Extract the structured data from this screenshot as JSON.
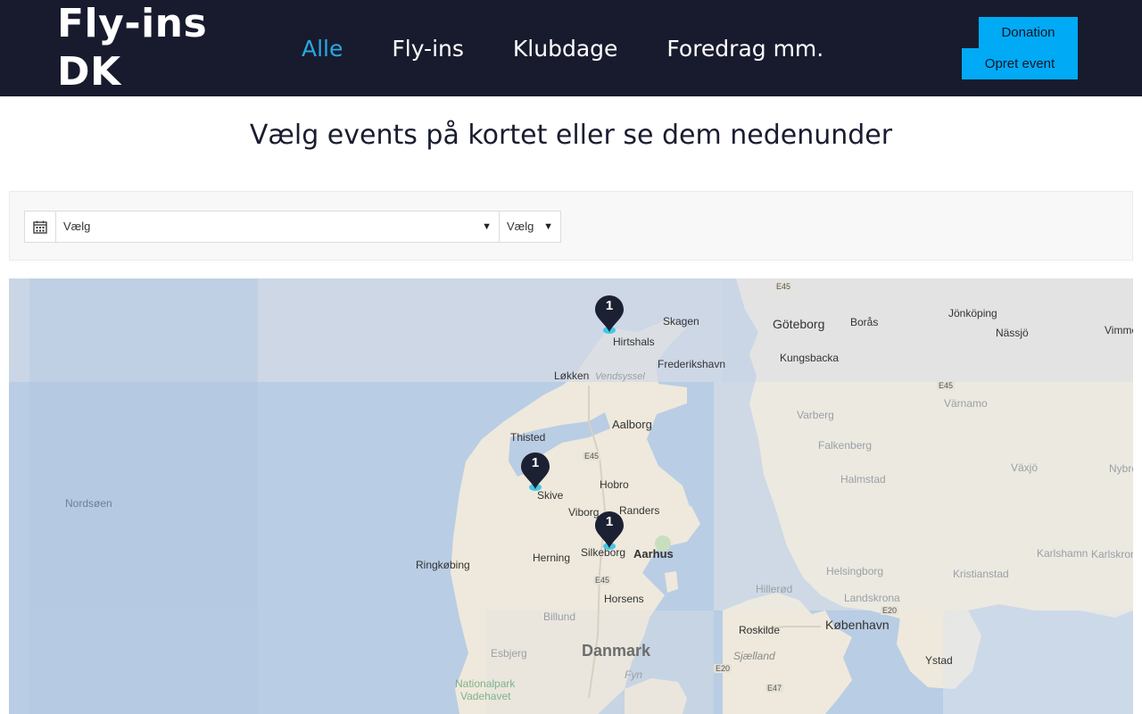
{
  "brand": {
    "line1": "Fly-ins",
    "line2": "DK"
  },
  "nav": [
    {
      "label": "Alle",
      "active": true
    },
    {
      "label": "Fly-ins",
      "active": false
    },
    {
      "label": "Klubdage",
      "active": false
    },
    {
      "label": "Foredrag mm.",
      "active": false
    }
  ],
  "buttons": {
    "donation": "Donation",
    "opret": "Opret event"
  },
  "colors": {
    "header_bg": "#181b2e",
    "accent": "#00aaf5",
    "active_nav": "#2aa8e0",
    "marker": "#1c2033"
  },
  "headline": "Vælg events på kortet eller se dem nedenunder",
  "filters": {
    "calendar_icon": "calendar-icon",
    "select_1": "Vælg",
    "select_2": "Vælg"
  },
  "map": {
    "sea_label": "Nordsøen",
    "country_label": "Danmark",
    "cities": {
      "skagen": "Skagen",
      "hirtshals": "Hirtshals",
      "frederikshavn": "Frederikshavn",
      "lokken": "Løkken",
      "vendsyssel": "Vendsyssel",
      "aalborg": "Aalborg",
      "thisted": "Thisted",
      "hobro": "Hobro",
      "skive": "Skive",
      "viborg": "Viborg",
      "randers": "Randers",
      "silkeborg": "Silkeborg",
      "aarhus": "Aarhus",
      "herning": "Herning",
      "ringkobing": "Ringkøbing",
      "horsens": "Horsens",
      "billund": "Billund",
      "esbjerg": "Esbjerg",
      "nationalpark": "Nationalpark",
      "vadehavet": "Vadehavet",
      "goteborg": "Göteborg",
      "boras": "Borås",
      "kungsbacka": "Kungsbacka",
      "jonkoping": "Jönköping",
      "nassjo": "Nässjö",
      "vimmerby": "Vimmerby",
      "varberg": "Varberg",
      "varnamo": "Värnamo",
      "falkenberg": "Falkenberg",
      "vaxjo": "Växjö",
      "halmstad": "Halmstad",
      "nybro": "Nybro",
      "karlshamn": "Karlshamn",
      "karlskrona": "Karlskrona",
      "helsingborg": "Helsingborg",
      "kristianstad": "Kristianstad",
      "hillerod": "Hillerød",
      "landskrona": "Landskrona",
      "roskilde": "Roskilde",
      "kobenhavn": "København",
      "ystad": "Ystad",
      "sjaelland": "Sjælland",
      "fyn": "Fyn"
    },
    "roads": [
      "E45",
      "E45",
      "E45",
      "E20",
      "E47",
      "E20",
      "E45"
    ],
    "markers": [
      {
        "count": "1"
      },
      {
        "count": "1"
      },
      {
        "count": "1"
      }
    ]
  }
}
